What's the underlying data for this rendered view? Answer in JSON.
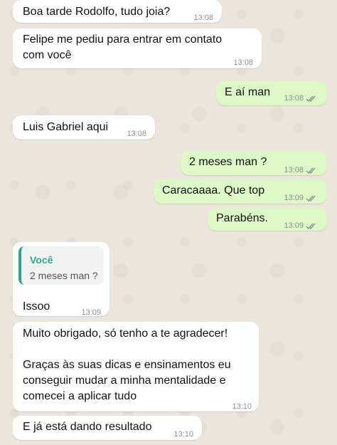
{
  "messages": [
    {
      "dir": "in",
      "text": "Boa tarde Rodolfo, tudo joia?",
      "time": "13:08"
    },
    {
      "dir": "in",
      "text": "Felipe me pediu para entrar em contato\ncom você",
      "time": "13:08"
    },
    {
      "dir": "out",
      "text": "E aí man",
      "time": "13:08",
      "status_icon": "double-check-icon"
    },
    {
      "dir": "in",
      "text": "Luis Gabriel aqui",
      "time": "13:08"
    },
    {
      "dir": "out",
      "text": "2 meses man ?",
      "time": "13:08",
      "status_icon": "double-check-icon"
    },
    {
      "dir": "out",
      "text": "Caracaaaa. Que top",
      "time": "13:09",
      "status_icon": "double-check-icon"
    },
    {
      "dir": "out",
      "text": "Parabéns.",
      "time": "13:09",
      "status_icon": "double-check-icon"
    },
    {
      "dir": "in",
      "reply": {
        "author": "Você",
        "text": "2 meses man ?"
      },
      "text": "Issoo",
      "time": "13:09"
    },
    {
      "dir": "in",
      "text": "Muito obrigado, só tenho a te agradecer!\n\nGraças às suas dicas e ensinamentos eu\nconseguir mudar a minha mentalidade e\ncomecei a aplicar tudo",
      "time": "13:10"
    },
    {
      "dir": "in",
      "text": "E já está dando resultado",
      "time": "13:10"
    }
  ],
  "colors": {
    "incoming": "#ffffff",
    "outgoing": "#dcf8c6",
    "tick": "#8a9196",
    "reply_accent": "#2fa58f"
  }
}
